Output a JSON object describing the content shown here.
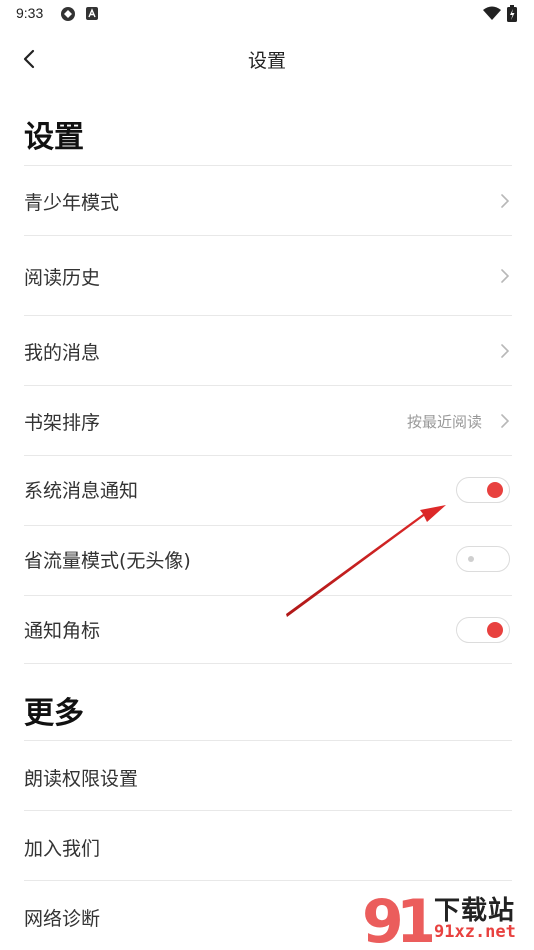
{
  "status_bar": {
    "time": "9:33",
    "icons": [
      "sync-icon",
      "a-badge-icon",
      "wifi-icon",
      "battery-icon"
    ]
  },
  "header": {
    "title": "设置",
    "back_icon": "chevron-left-icon"
  },
  "sections": {
    "settings": {
      "title": "设置",
      "items": [
        {
          "label": "青少年模式",
          "control": "chevron"
        },
        {
          "label": "阅读历史",
          "control": "chevron"
        },
        {
          "label": "我的消息",
          "control": "chevron"
        },
        {
          "label": "书架排序",
          "value": "按最近阅读",
          "control": "chevron"
        },
        {
          "label": "系统消息通知",
          "control": "toggle",
          "on": true
        },
        {
          "label": "省流量模式(无头像)",
          "control": "toggle",
          "on": false
        },
        {
          "label": "通知角标",
          "control": "toggle",
          "on": true
        }
      ]
    },
    "more": {
      "title": "更多",
      "items": [
        {
          "label": "朗读权限设置"
        },
        {
          "label": "加入我们"
        },
        {
          "label": "网络诊断"
        }
      ]
    }
  },
  "watermark": {
    "top_text": "下载站",
    "bottom_text": "91xz.net"
  },
  "colors": {
    "accent": "#e8413f",
    "annotation_arrow": "#d42020",
    "divider": "#e8e8e8",
    "secondary_text": "#999999"
  }
}
